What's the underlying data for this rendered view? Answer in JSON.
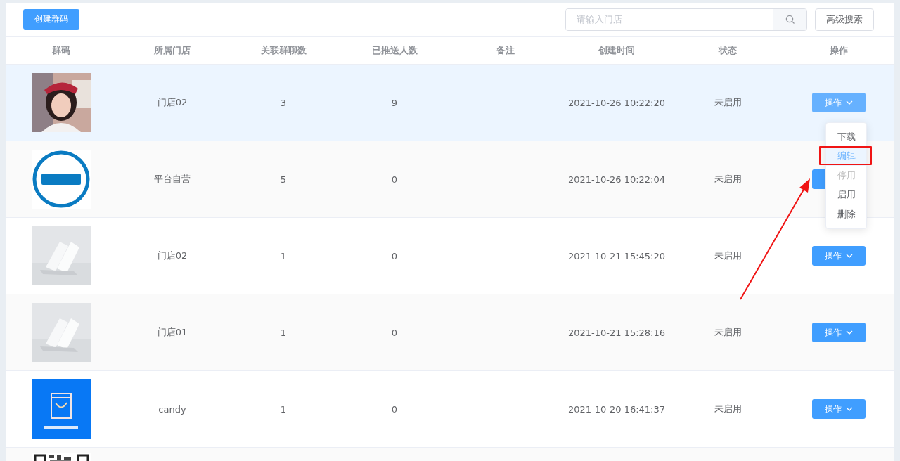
{
  "toolbar": {
    "create_button": "创建群码",
    "search": {
      "placeholder": "请输入门店"
    },
    "advanced_button": "高级搜索"
  },
  "table": {
    "columns": [
      "群码",
      "所属门店",
      "关联群聊数",
      "已推送人数",
      "备注",
      "创建时间",
      "状态",
      "操作"
    ],
    "rows": [
      {
        "store": "门店02",
        "groups": "3",
        "pushed": "9",
        "created": "2021-10-26 10:22:20",
        "status": "未启用",
        "action": "操作",
        "selected": true
      },
      {
        "store": "平台自营",
        "groups": "5",
        "pushed": "0",
        "created": "2021-10-26 10:22:04",
        "status": "未启用",
        "selected": false
      },
      {
        "store": "门店02",
        "groups": "1",
        "pushed": "0",
        "created": "2021-10-21 15:45:20",
        "status": "未启用",
        "action": "操作",
        "selected": false
      },
      {
        "store": "门店01",
        "groups": "1",
        "pushed": "0",
        "created": "2021-10-21 15:28:16",
        "status": "未启用",
        "action": "操作",
        "selected": false
      },
      {
        "store": "candy",
        "groups": "1",
        "pushed": "0",
        "created": "2021-10-20 16:41:37",
        "status": "未启用",
        "action": "操作",
        "selected": false
      },
      {
        "selected": false
      }
    ]
  },
  "menu": {
    "open": true,
    "items": [
      {
        "label": "下载",
        "hovered": false,
        "disabled": false,
        "marked": false
      },
      {
        "label": "编辑",
        "hovered": true,
        "disabled": false,
        "marked": true
      },
      {
        "label": "停用",
        "hovered": false,
        "disabled": true,
        "marked": false
      },
      {
        "label": "启用",
        "hovered": false,
        "disabled": false,
        "marked": false
      },
      {
        "label": "删除",
        "hovered": false,
        "disabled": false,
        "marked": false
      }
    ]
  },
  "annotation": {
    "arrow": true
  }
}
